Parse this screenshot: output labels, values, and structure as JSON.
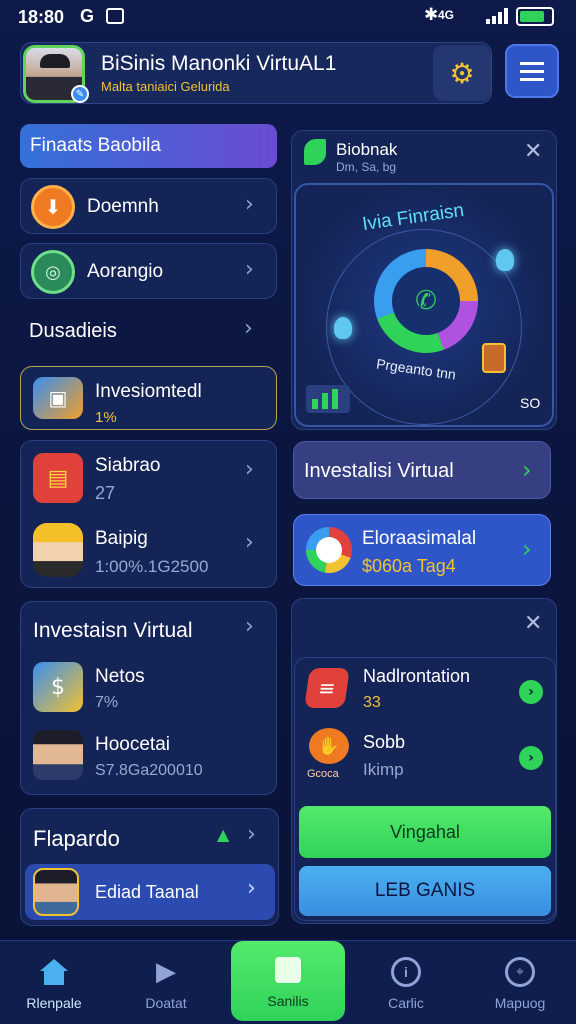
{
  "status_bar": {
    "time": "18:80",
    "g_label": "G",
    "signal": "4G"
  },
  "header": {
    "title": "BiSinis Manonki VirtuAL1",
    "subtitle": "Malta taniaici  Gelurida"
  },
  "left": {
    "section_title": "Finaats Baobila",
    "menu": [
      {
        "label": "Doemnh"
      },
      {
        "label": "Aorangio"
      }
    ],
    "section2": "Dusadieis",
    "invest_card": {
      "label": "Invesiomtedl",
      "value": "1%"
    },
    "stats": [
      {
        "label": "Siabrao",
        "value": "27"
      },
      {
        "label": "Baipig",
        "value": "1:00%.1G2500"
      }
    ],
    "virtual_card": {
      "title": "Investaisn Virtual",
      "items": [
        {
          "label": "Netos",
          "value": "7%"
        },
        {
          "label": "Hoocetai",
          "value": "S7.8Ga200010"
        }
      ]
    },
    "leaderboard": {
      "title": "Flapardo",
      "item": "Ediad Taanal"
    }
  },
  "right": {
    "chart_card": {
      "title": "Biobnak",
      "subtitle": "Dm, Sa, bg",
      "ring_title": "Ivia Finraisn",
      "ring_caption": "Prgeanto tnn",
      "corner_value": "SO"
    },
    "virtual_btn": "Investalisi Virtual",
    "econ_card": {
      "label": "Eloraasimalal",
      "value": "$060a Tag4"
    },
    "news_card": {
      "items": [
        {
          "label": "Nadlrontation",
          "value": "33"
        },
        {
          "label": "Sobb",
          "value": "Ikimp",
          "icon_caption": "Gcoca"
        }
      ],
      "btn_green": "Vingahal",
      "btn_blue": "LEB GANIS"
    }
  },
  "nav": [
    {
      "label": "Rlenpale",
      "icon": "home-icon"
    },
    {
      "label": "Doatat",
      "icon": "play-icon"
    },
    {
      "label": "Sanilis",
      "icon": "cube-icon"
    },
    {
      "label": "Carlic",
      "icon": "info-icon"
    },
    {
      "label": "Mapuog",
      "icon": "map-icon"
    }
  ],
  "colors": {
    "background": "#0b1640",
    "card": "#142456",
    "accent_green": "#2fd35a",
    "accent_blue": "#3a74e0",
    "accent_gold": "#f1c232",
    "section_purple": "#5a4fd6"
  }
}
